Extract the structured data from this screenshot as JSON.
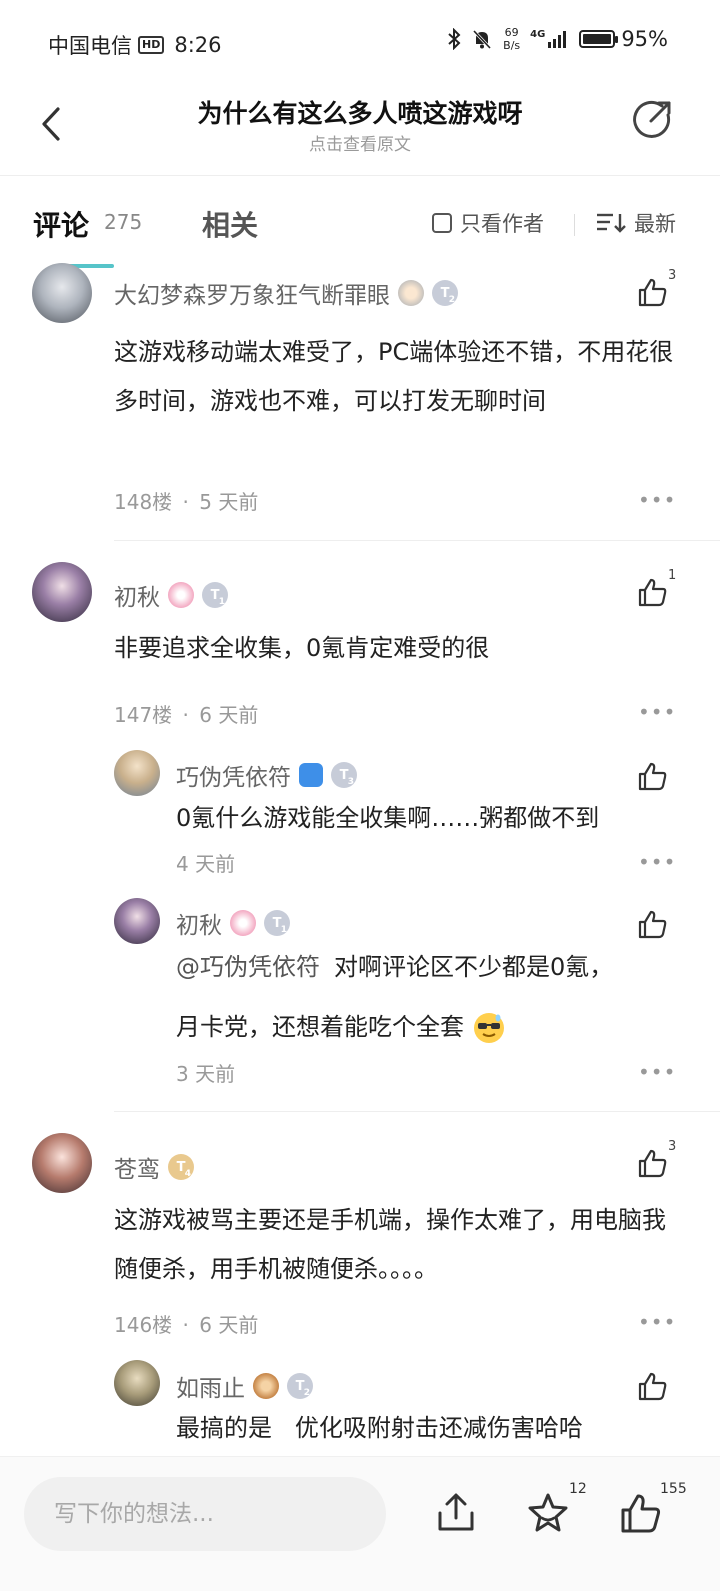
{
  "status_bar": {
    "carrier": "中国电信",
    "hd": "HD",
    "time": "8:26",
    "net_speed_value": "69",
    "net_speed_unit": "B/s",
    "signal": "4G",
    "battery": "95%"
  },
  "header": {
    "title": "为什么有这么多人喷这游戏呀",
    "subtitle": "点击查看原文"
  },
  "tabs": {
    "comments_label": "评论",
    "comments_count": "275",
    "related_label": "相关",
    "author_only_label": "只看作者",
    "sort_label": "最新"
  },
  "comments": [
    {
      "user": "大幻梦森罗万象狂气断罪眼",
      "level": "2",
      "text": "这游戏移动端太难受了，PC端体验还不错，不用花很多时间，游戏也不难，可以打发无聊时间",
      "floor": "148楼",
      "time": "5 天前",
      "likes": "3"
    },
    {
      "user": "初秋",
      "level": "1",
      "text": "非要追求全收集，0氪肯定难受的很",
      "floor": "147楼",
      "time": "6 天前",
      "likes": "1",
      "replies": [
        {
          "user": "巧伪凭依符",
          "level": "3",
          "text": "0氪什么游戏能全收集啊……粥都做不到",
          "time": "4 天前"
        },
        {
          "user": "初秋",
          "level": "1",
          "mention": "@巧伪凭依符",
          "text_line1": "对啊评论区不少都是0氪，",
          "text_line2": "月卡党，还想着能吃个全套",
          "time": "3 天前"
        }
      ]
    },
    {
      "user": "苍鸾",
      "level": "4",
      "text": "这游戏被骂主要还是手机端，操作太难了，用电脑我随便杀，用手机被随便杀。。。。",
      "floor": "146楼",
      "time": "6 天前",
      "likes": "3",
      "replies": [
        {
          "user": "如雨止",
          "level": "2",
          "text": "最搞的是   优化吸附射击还减伤害哈哈"
        }
      ]
    }
  ],
  "meta_sep": "·",
  "bottom_bar": {
    "input_placeholder": "写下你的想法...",
    "star_count": "12",
    "like_count": "155"
  },
  "colors": {
    "accent": "#56c4c9",
    "text_primary": "#222222",
    "text_secondary": "#999999"
  },
  "icons": [
    "back-arrow-icon",
    "share-icon",
    "checkbox-icon",
    "sort-icon",
    "thumbs-up-icon",
    "more-icon",
    "upload-icon",
    "star-icon"
  ]
}
